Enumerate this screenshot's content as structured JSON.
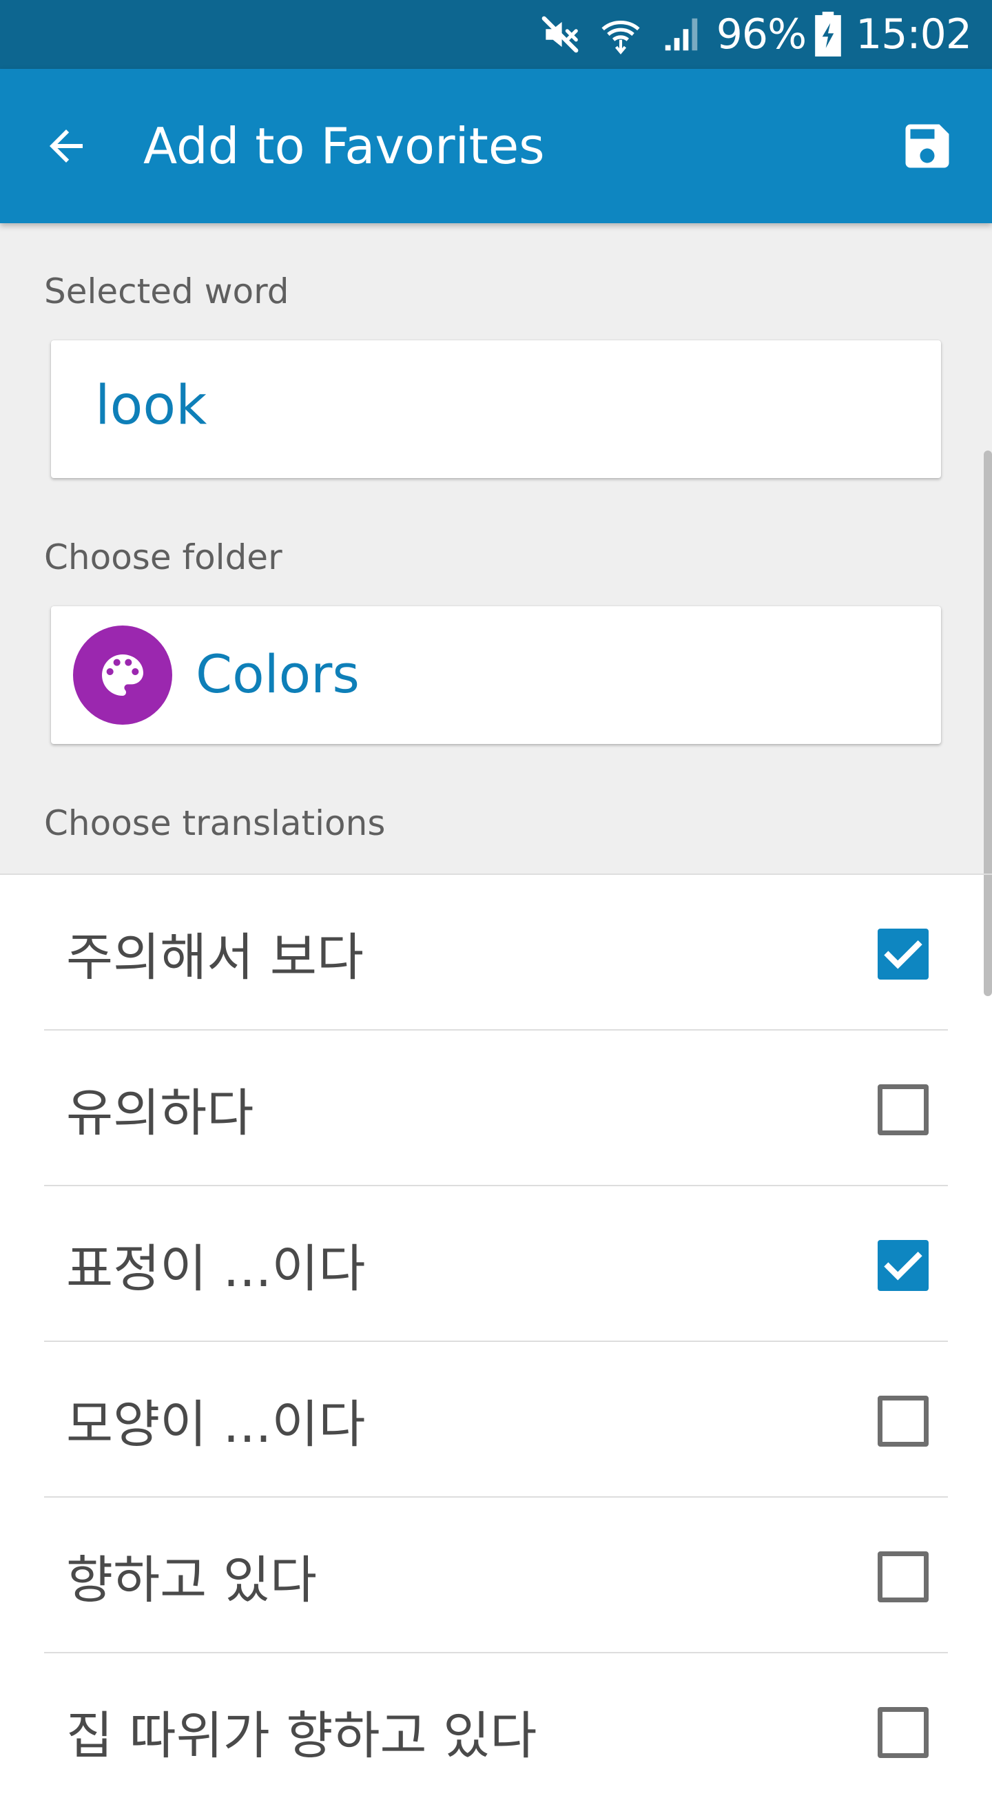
{
  "status_bar": {
    "battery": "96%",
    "time": "15:02",
    "icons": [
      "mute-icon",
      "wifi-icon",
      "signal-icon",
      "battery-charging-icon"
    ]
  },
  "app_bar": {
    "title": "Add to Favorites",
    "back_icon": "arrow-back-icon",
    "save_icon": "save-icon",
    "color": "#0e86c1"
  },
  "selected_word": {
    "label": "Selected word",
    "value": "look"
  },
  "folder": {
    "label": "Choose folder",
    "name": "Colors",
    "icon": "palette-icon",
    "icon_color": "#9b27af"
  },
  "translations": {
    "label": "Choose translations",
    "items": [
      {
        "text": "주의해서 보다",
        "checked": true
      },
      {
        "text": "유의하다",
        "checked": false
      },
      {
        "text": "표정이 ...이다",
        "checked": true
      },
      {
        "text": "모양이 ...이다",
        "checked": false
      },
      {
        "text": "향하고 있다",
        "checked": false
      },
      {
        "text": "집 따위가 향하고 있다",
        "checked": false
      }
    ]
  }
}
